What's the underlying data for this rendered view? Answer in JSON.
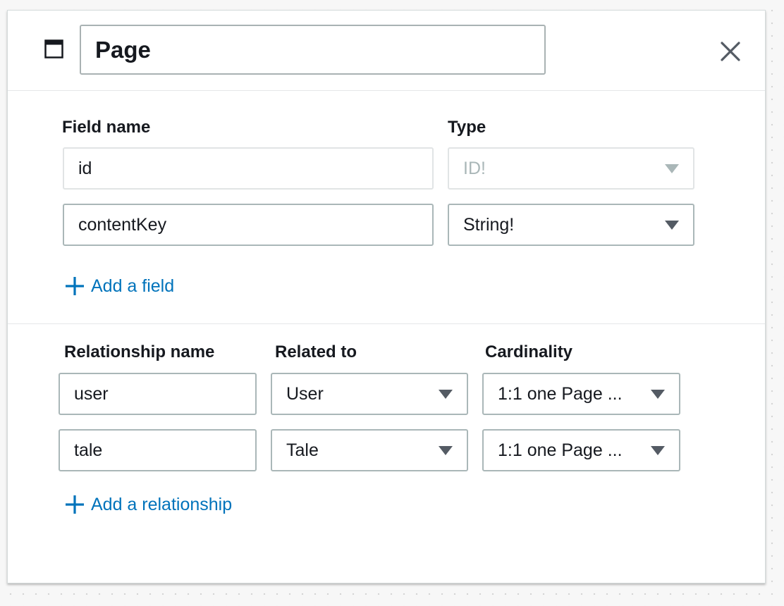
{
  "panel": {
    "title_value": "Page",
    "icons": {
      "window": "window-icon",
      "close": "close-icon",
      "add": "plus-icon",
      "dropdown": "caret-down-icon"
    }
  },
  "fields": {
    "name_header": "Field name",
    "type_header": "Type",
    "rows": [
      {
        "name": "id",
        "type": "ID!",
        "disabled": true
      },
      {
        "name": "contentKey",
        "type": "String!",
        "disabled": false
      }
    ],
    "add_label": "Add a field"
  },
  "relationships": {
    "name_header": "Relationship name",
    "related_header": "Related to",
    "cardinality_header": "Cardinality",
    "rows": [
      {
        "name": "user",
        "related_to": "User",
        "cardinality": "1:1 one Page ..."
      },
      {
        "name": "tale",
        "related_to": "Tale",
        "cardinality": "1:1 one Page ..."
      }
    ],
    "add_label": "Add a relationship"
  },
  "colors": {
    "link": "#0073bb",
    "border": "#aab7b8",
    "disabled": "#aab7b8",
    "text": "#16191f"
  }
}
